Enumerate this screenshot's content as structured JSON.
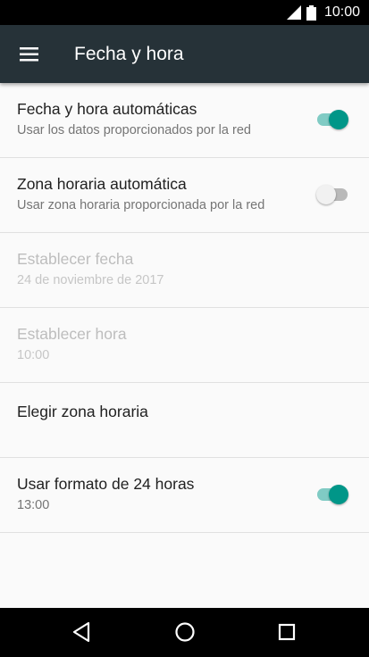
{
  "status_bar": {
    "time": "10:00",
    "icons": [
      "signal-icon",
      "battery-icon"
    ]
  },
  "app_bar": {
    "title": "Fecha y hora",
    "menu_icon": "menu-icon",
    "background": "#263238"
  },
  "settings": [
    {
      "title": "Fecha y hora automáticas",
      "subtitle": "Usar los datos proporcionados por la red",
      "toggle": true,
      "enabled": true
    },
    {
      "title": "Zona horaria automática",
      "subtitle": "Usar zona horaria proporcionada por la red",
      "toggle": false,
      "enabled": true
    },
    {
      "title": "Establecer fecha",
      "subtitle": "24 de noviembre de 2017",
      "enabled": false
    },
    {
      "title": "Establecer hora",
      "subtitle": "10:00",
      "enabled": false
    },
    {
      "title": "Elegir zona horaria",
      "enabled": true
    },
    {
      "title": "Usar formato de 24 horas",
      "subtitle": "13:00",
      "toggle": true,
      "enabled": true
    }
  ],
  "nav_bar": {
    "icons": [
      "back-icon",
      "home-icon",
      "recents-icon"
    ]
  },
  "colors": {
    "accent": "#009688",
    "accent_track": "#80cbc4"
  }
}
